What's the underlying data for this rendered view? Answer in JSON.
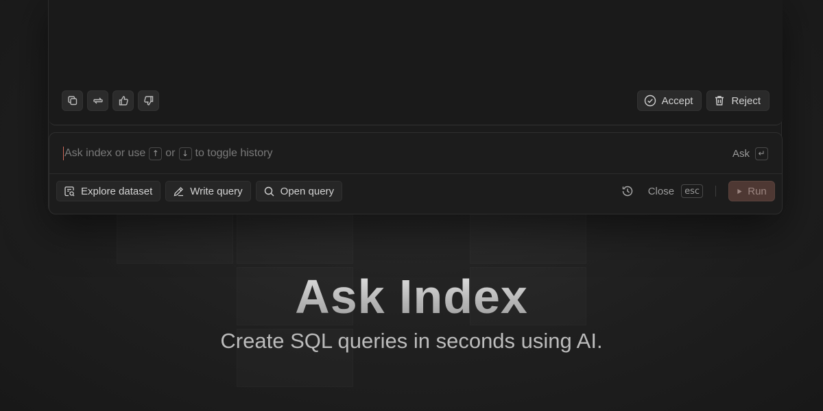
{
  "response_panel": {
    "actions": [
      {
        "name": "copy-icon",
        "label": "Copy"
      },
      {
        "name": "regenerate-icon",
        "label": "Regenerate"
      },
      {
        "name": "thumbs-up-icon",
        "label": "Thumbs up"
      },
      {
        "name": "thumbs-down-icon",
        "label": "Thumbs down"
      }
    ],
    "accept_label": "Accept",
    "reject_label": "Reject"
  },
  "prompt": {
    "placeholder_start": "Ask index or use",
    "key_up": "↑",
    "or": "or",
    "key_down": "↓",
    "placeholder_end": "to toggle history",
    "ask_label": "Ask",
    "ask_key": "↵"
  },
  "toolbar": {
    "explore_label": "Explore dataset",
    "write_label": "Write query",
    "open_label": "Open query",
    "close_label": "Close",
    "close_key": "esc",
    "run_label": "Run"
  },
  "hero": {
    "title": "Ask Index",
    "subtitle": "Create SQL queries in seconds using AI."
  },
  "colors": {
    "background": "#1f1f1f",
    "panel": "#1b1b1b",
    "run_button": "#4e3833",
    "caret": "#d06a5a"
  }
}
